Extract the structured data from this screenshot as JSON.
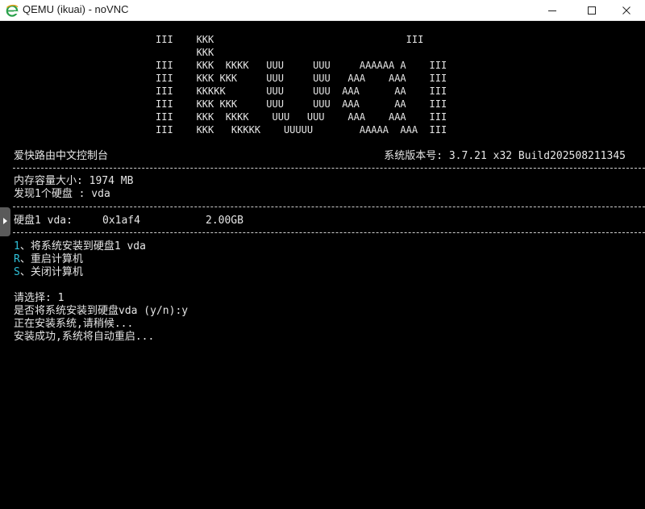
{
  "window": {
    "title": "QEMU (ikuai) - noVNC"
  },
  "logo": [
    "III    KKK                                 III",
    "       KKK",
    "III    KKK  KKKK   UUU     UUU     AAAAAA A    III",
    "III    KKK KKK     UUU     UUU   AAA    AAA    III",
    "III    KKKKK       UUU     UUU  AAA      AA    III",
    "III    KKK KKK     UUU     UUU  AAA      AA    III",
    "III    KKK  KKKK    UUU   UUU    AAA    AAA    III",
    "III    KKK   KKKKK    UUUUU        AAAAA  AAA  III"
  ],
  "header": {
    "console_title": "爱快路由中文控制台",
    "version": "系统版本号: 3.7.21 x32 Build202508211345"
  },
  "system": {
    "memory": "内存容量大小: 1974 MB",
    "disks_found": "发现1个硬盘 : vda"
  },
  "disk": {
    "label": "硬盘1 vda:",
    "id": "0x1af4",
    "size": "2.00GB"
  },
  "menu": [
    {
      "key": "1",
      "label": "、将系统安装到硬盘1 vda"
    },
    {
      "key": "R",
      "label": "、重启计算机"
    },
    {
      "key": "S",
      "label": "、关闭计算机"
    }
  ],
  "log": [
    "请选择: 1",
    "是否将系统安装到硬盘vda (y/n):y",
    "正在安装系统,请稍候...",
    "安装成功,系统将自动重启..."
  ],
  "colors": {
    "terminal_bg": "#000000",
    "terminal_fg": "#e6e6e6",
    "menu_key": "#2fc0d8",
    "titlebar_bg": "#ffffff"
  },
  "icons": {
    "app": "ie-e-icon",
    "minimize": "minimize-icon",
    "maximize": "maximize-icon",
    "close": "close-icon",
    "novnc_control_bar": "chevron-right-icon"
  }
}
